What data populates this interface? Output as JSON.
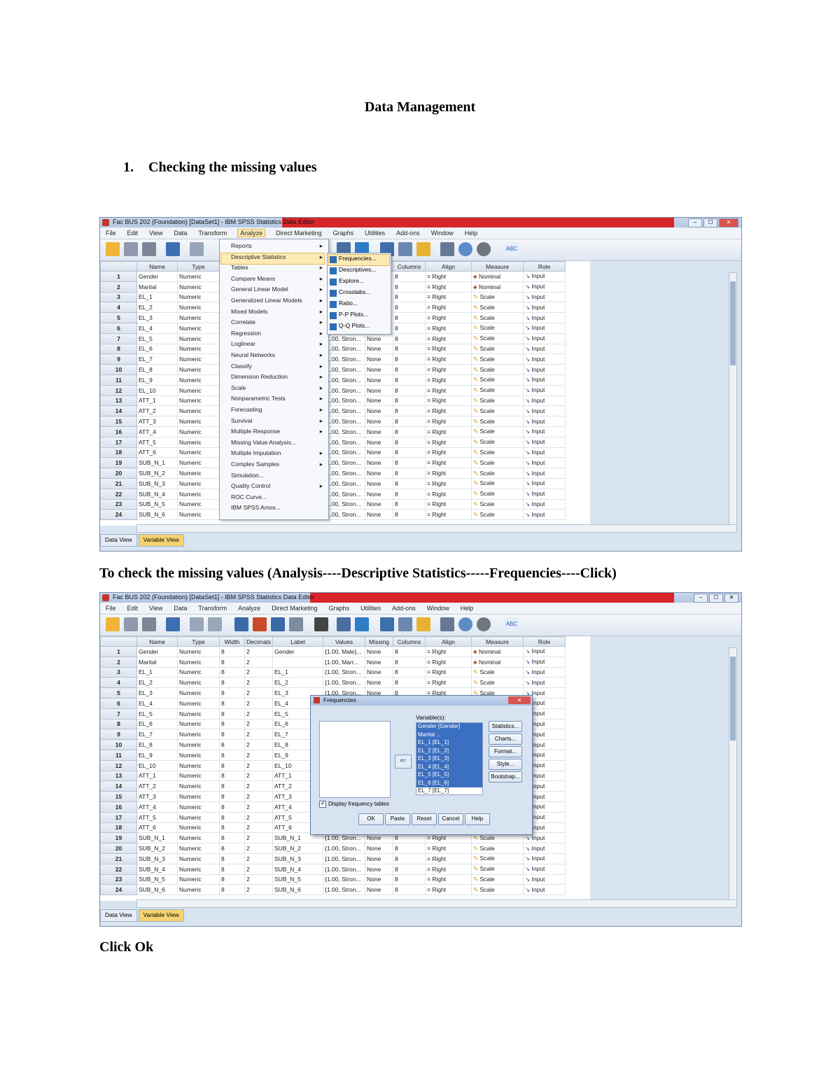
{
  "doc": {
    "title": "Data Management",
    "heading_number": "1.",
    "heading_text": "Checking the missing values",
    "instruction": "To check the missing values (Analysis----Descriptive Statistics-----Frequencies----Click)",
    "click_ok": "Click Ok"
  },
  "win1": {
    "title": "Fac BUS 202 (Foundation) [DataSet1] - IBM SPSS Statistics Data Editor",
    "controls": [
      "–",
      "☐",
      "✕"
    ],
    "menu": [
      "File",
      "Edit",
      "View",
      "Data",
      "Transform",
      "Analyze",
      "Direct Marketing",
      "Graphs",
      "Utilities",
      "Add-ons",
      "Window",
      "Help"
    ],
    "columns": [
      "",
      "Name",
      "Type",
      "Width",
      "Decimals",
      "Label",
      "Values",
      "Missing",
      "Columns",
      "Align",
      "Measure",
      "Role"
    ],
    "analyze_menu": [
      "Reports",
      "Descriptive Statistics",
      "Tables",
      "Compare Means",
      "General Linear Model",
      "Generalized Linear Models",
      "Mixed Models",
      "Correlate",
      "Regression",
      "Loglinear",
      "Neural Networks",
      "Classify",
      "Dimension Reduction",
      "Scale",
      "Nonparametric Tests",
      "Forecasting",
      "Survival",
      "Multiple Response",
      "Missing Value Analysis...",
      "Multiple Imputation",
      "Complex Samples",
      "Simulation...",
      "Quality Control",
      "ROC Curve...",
      "IBM SPSS Amos..."
    ],
    "descriptive_submenu": [
      "Frequencies...",
      "Descriptives...",
      "Explore...",
      "Crosstabs...",
      "Ratio...",
      "P-P Plots...",
      "Q-Q Plots..."
    ],
    "tabs": [
      "Data View",
      "Variable View"
    ]
  },
  "win2": {
    "title": "Fac BUS 202 (Foundation) [DataSet1] - IBM SPSS Statistics Data Editor",
    "controls": [
      "–",
      "☐",
      "✕"
    ],
    "menu": [
      "File",
      "Edit",
      "View",
      "Data",
      "Transform",
      "Analyze",
      "Direct Marketing",
      "Graphs",
      "Utilities",
      "Add-ons",
      "Window",
      "Help"
    ],
    "columns": [
      "",
      "Name",
      "Type",
      "Width",
      "Decimals",
      "Label",
      "Values",
      "Missing",
      "Columns",
      "Align",
      "Measure",
      "Role"
    ],
    "tabs": [
      "Data View",
      "Variable View"
    ],
    "dialog": {
      "title": "Frequencies",
      "variables_label": "Variable(s):",
      "variables": [
        "Gender [Gender]",
        "Marital ...",
        "EL_1 [EL_1]",
        "EL_2 [EL_2]",
        "EL_3 [EL_3]",
        "EL_4 [EL_4]",
        "EL_5 [EL_5]",
        "EL_6 [EL_6]",
        "EL_7 [EL_7]"
      ],
      "side_buttons": [
        "Statistics...",
        "Charts...",
        "Format...",
        "Style...",
        "Bootstrap..."
      ],
      "checkbox": "Display frequency tables",
      "bottom_buttons": [
        "OK",
        "Paste",
        "Reset",
        "Cancel",
        "Help"
      ]
    }
  },
  "rows": [
    {
      "n": "1",
      "name": "Gender",
      "type": "Numeric",
      "width": "8",
      "dec": "2",
      "label": "Gender",
      "values": "{1.00, Male}...",
      "missing": "None",
      "cols": "8",
      "align": "Right",
      "measure": "Nominal",
      "role": "Input"
    },
    {
      "n": "2",
      "name": "Marital",
      "type": "Numeric",
      "width": "8",
      "dec": "2",
      "label": "",
      "values": "{1.00, Marr...",
      "missing": "None",
      "cols": "8",
      "align": "Right",
      "measure": "Nominal",
      "role": "Input"
    },
    {
      "n": "3",
      "name": "EL_1",
      "type": "Numeric",
      "width": "8",
      "dec": "2",
      "label": "EL_1",
      "values": "{1.00, Stron...",
      "missing": "None",
      "cols": "8",
      "align": "Right",
      "measure": "Scale",
      "role": "Input"
    },
    {
      "n": "4",
      "name": "EL_2",
      "type": "Numeric",
      "width": "8",
      "dec": "2",
      "label": "EL_2",
      "values": "{1.00, Stron...",
      "missing": "None",
      "cols": "8",
      "align": "Right",
      "measure": "Scale",
      "role": "Input"
    },
    {
      "n": "5",
      "name": "EL_3",
      "type": "Numeric",
      "width": "8",
      "dec": "2",
      "label": "EL_3",
      "values": "{1.00, Stron...",
      "missing": "None",
      "cols": "8",
      "align": "Right",
      "measure": "Scale",
      "role": "Input"
    },
    {
      "n": "6",
      "name": "EL_4",
      "type": "Numeric",
      "width": "8",
      "dec": "2",
      "label": "EL_4",
      "values": "{1.00, Stron...",
      "missing": "None",
      "cols": "8",
      "align": "Right",
      "measure": "Scale",
      "role": "Input"
    },
    {
      "n": "7",
      "name": "EL_5",
      "type": "Numeric",
      "width": "8",
      "dec": "2",
      "label": "EL_5",
      "values": "{1.00, Stron...",
      "missing": "None",
      "cols": "8",
      "align": "Right",
      "measure": "Scale",
      "role": "Input"
    },
    {
      "n": "8",
      "name": "EL_6",
      "type": "Numeric",
      "width": "8",
      "dec": "2",
      "label": "EL_6",
      "values": "{1.00, Stron...",
      "missing": "None",
      "cols": "8",
      "align": "Right",
      "measure": "Scale",
      "role": "Input"
    },
    {
      "n": "9",
      "name": "EL_7",
      "type": "Numeric",
      "width": "8",
      "dec": "2",
      "label": "EL_7",
      "values": "{1.00, Stron...",
      "missing": "None",
      "cols": "8",
      "align": "Right",
      "measure": "Scale",
      "role": "Input"
    },
    {
      "n": "10",
      "name": "EL_8",
      "type": "Numeric",
      "width": "8",
      "dec": "2",
      "label": "EL_8",
      "values": "{1.00, Stron...",
      "missing": "None",
      "cols": "8",
      "align": "Right",
      "measure": "Scale",
      "role": "Input"
    },
    {
      "n": "11",
      "name": "EL_9",
      "type": "Numeric",
      "width": "8",
      "dec": "2",
      "label": "EL_9",
      "values": "{1.00, Stron...",
      "missing": "None",
      "cols": "8",
      "align": "Right",
      "measure": "Scale",
      "role": "Input"
    },
    {
      "n": "12",
      "name": "EL_10",
      "type": "Numeric",
      "width": "8",
      "dec": "2",
      "label": "EL_10",
      "values": "{1.00, Stron...",
      "missing": "None",
      "cols": "8",
      "align": "Right",
      "measure": "Scale",
      "role": "Input"
    },
    {
      "n": "13",
      "name": "ATT_1",
      "type": "Numeric",
      "width": "8",
      "dec": "2",
      "label": "ATT_1",
      "values": "{1.00, Stron...",
      "missing": "None",
      "cols": "8",
      "align": "Right",
      "measure": "Scale",
      "role": "Input"
    },
    {
      "n": "14",
      "name": "ATT_2",
      "type": "Numeric",
      "width": "8",
      "dec": "2",
      "label": "ATT_2",
      "values": "{1.00, Stron...",
      "missing": "None",
      "cols": "8",
      "align": "Right",
      "measure": "Scale",
      "role": "Input"
    },
    {
      "n": "15",
      "name": "ATT_3",
      "type": "Numeric",
      "width": "8",
      "dec": "2",
      "label": "ATT_3",
      "values": "{1.00, Stron...",
      "missing": "None",
      "cols": "8",
      "align": "Right",
      "measure": "Scale",
      "role": "Input"
    },
    {
      "n": "16",
      "name": "ATT_4",
      "type": "Numeric",
      "width": "8",
      "dec": "2",
      "label": "ATT_4",
      "values": "{1.00, Stron...",
      "missing": "None",
      "cols": "8",
      "align": "Right",
      "measure": "Scale",
      "role": "Input"
    },
    {
      "n": "17",
      "name": "ATT_5",
      "type": "Numeric",
      "width": "8",
      "dec": "2",
      "label": "ATT_5",
      "values": "{1.00, Stron...",
      "missing": "None",
      "cols": "8",
      "align": "Right",
      "measure": "Scale",
      "role": "Input"
    },
    {
      "n": "18",
      "name": "ATT_6",
      "type": "Numeric",
      "width": "8",
      "dec": "2",
      "label": "ATT_6",
      "values": "{1.00, Stron...",
      "missing": "None",
      "cols": "8",
      "align": "Right",
      "measure": "Scale",
      "role": "Input"
    },
    {
      "n": "19",
      "name": "SUB_N_1",
      "type": "Numeric",
      "width": "8",
      "dec": "2",
      "label": "SUB_N_1",
      "values": "{1.00, Stron...",
      "missing": "None",
      "cols": "8",
      "align": "Right",
      "measure": "Scale",
      "role": "Input"
    },
    {
      "n": "20",
      "name": "SUB_N_2",
      "type": "Numeric",
      "width": "8",
      "dec": "2",
      "label": "SUB_N_2",
      "values": "{1.00, Stron...",
      "missing": "None",
      "cols": "8",
      "align": "Right",
      "measure": "Scale",
      "role": "Input"
    },
    {
      "n": "21",
      "name": "SUB_N_3",
      "type": "Numeric",
      "width": "8",
      "dec": "2",
      "label": "SUB_N_3",
      "values": "{1.00, Stron...",
      "missing": "None",
      "cols": "8",
      "align": "Right",
      "measure": "Scale",
      "role": "Input"
    },
    {
      "n": "22",
      "name": "SUB_N_4",
      "type": "Numeric",
      "width": "8",
      "dec": "2",
      "label": "SUB_N_4",
      "values": "{1.00, Stron...",
      "missing": "None",
      "cols": "8",
      "align": "Right",
      "measure": "Scale",
      "role": "Input"
    },
    {
      "n": "23",
      "name": "SUB_N_5",
      "type": "Numeric",
      "width": "8",
      "dec": "2",
      "label": "SUB_N_5",
      "values": "{1.00, Stron...",
      "missing": "None",
      "cols": "8",
      "align": "Right",
      "measure": "Scale",
      "role": "Input"
    },
    {
      "n": "24",
      "name": "SUB_N_6",
      "type": "Numeric",
      "width": "8",
      "dec": "2",
      "label": "SUB_N_6",
      "values": "{1.00, Stron...",
      "missing": "None",
      "cols": "8",
      "align": "Right",
      "measure": "Scale",
      "role": "Input"
    }
  ]
}
